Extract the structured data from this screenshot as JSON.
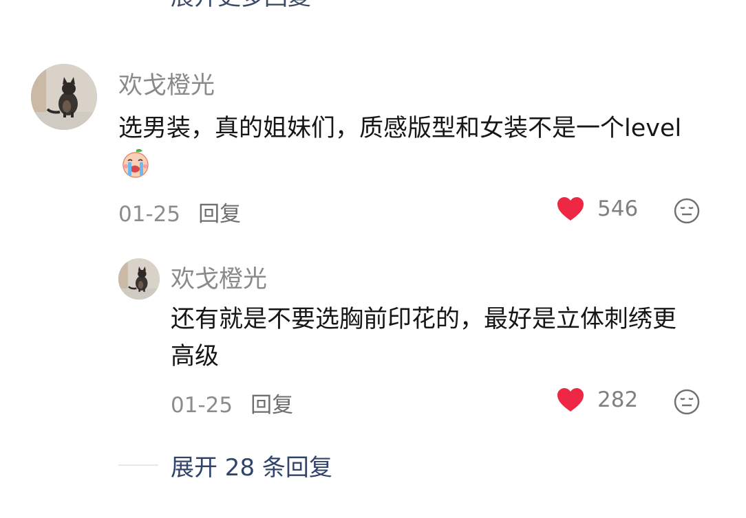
{
  "top_expand": {
    "label": "展开更多回复"
  },
  "comment": {
    "username": "欢戈橙光",
    "text": "选男装，真的姐妹们，质感版型和女装不是一个level",
    "emoji": "crying-peach-emoji",
    "date": "01-25",
    "reply_label": "回复",
    "likes": "546"
  },
  "reply": {
    "username": "欢戈橙光",
    "text": "还有就是不要选胸前印花的，最好是立体刺绣更高级",
    "date": "01-25",
    "reply_label": "回复",
    "likes": "282"
  },
  "expand_replies": {
    "label": "展开 28 条回复"
  },
  "colors": {
    "heart": "#ee2844",
    "link": "#30436b",
    "meta": "#8c8c8c"
  }
}
